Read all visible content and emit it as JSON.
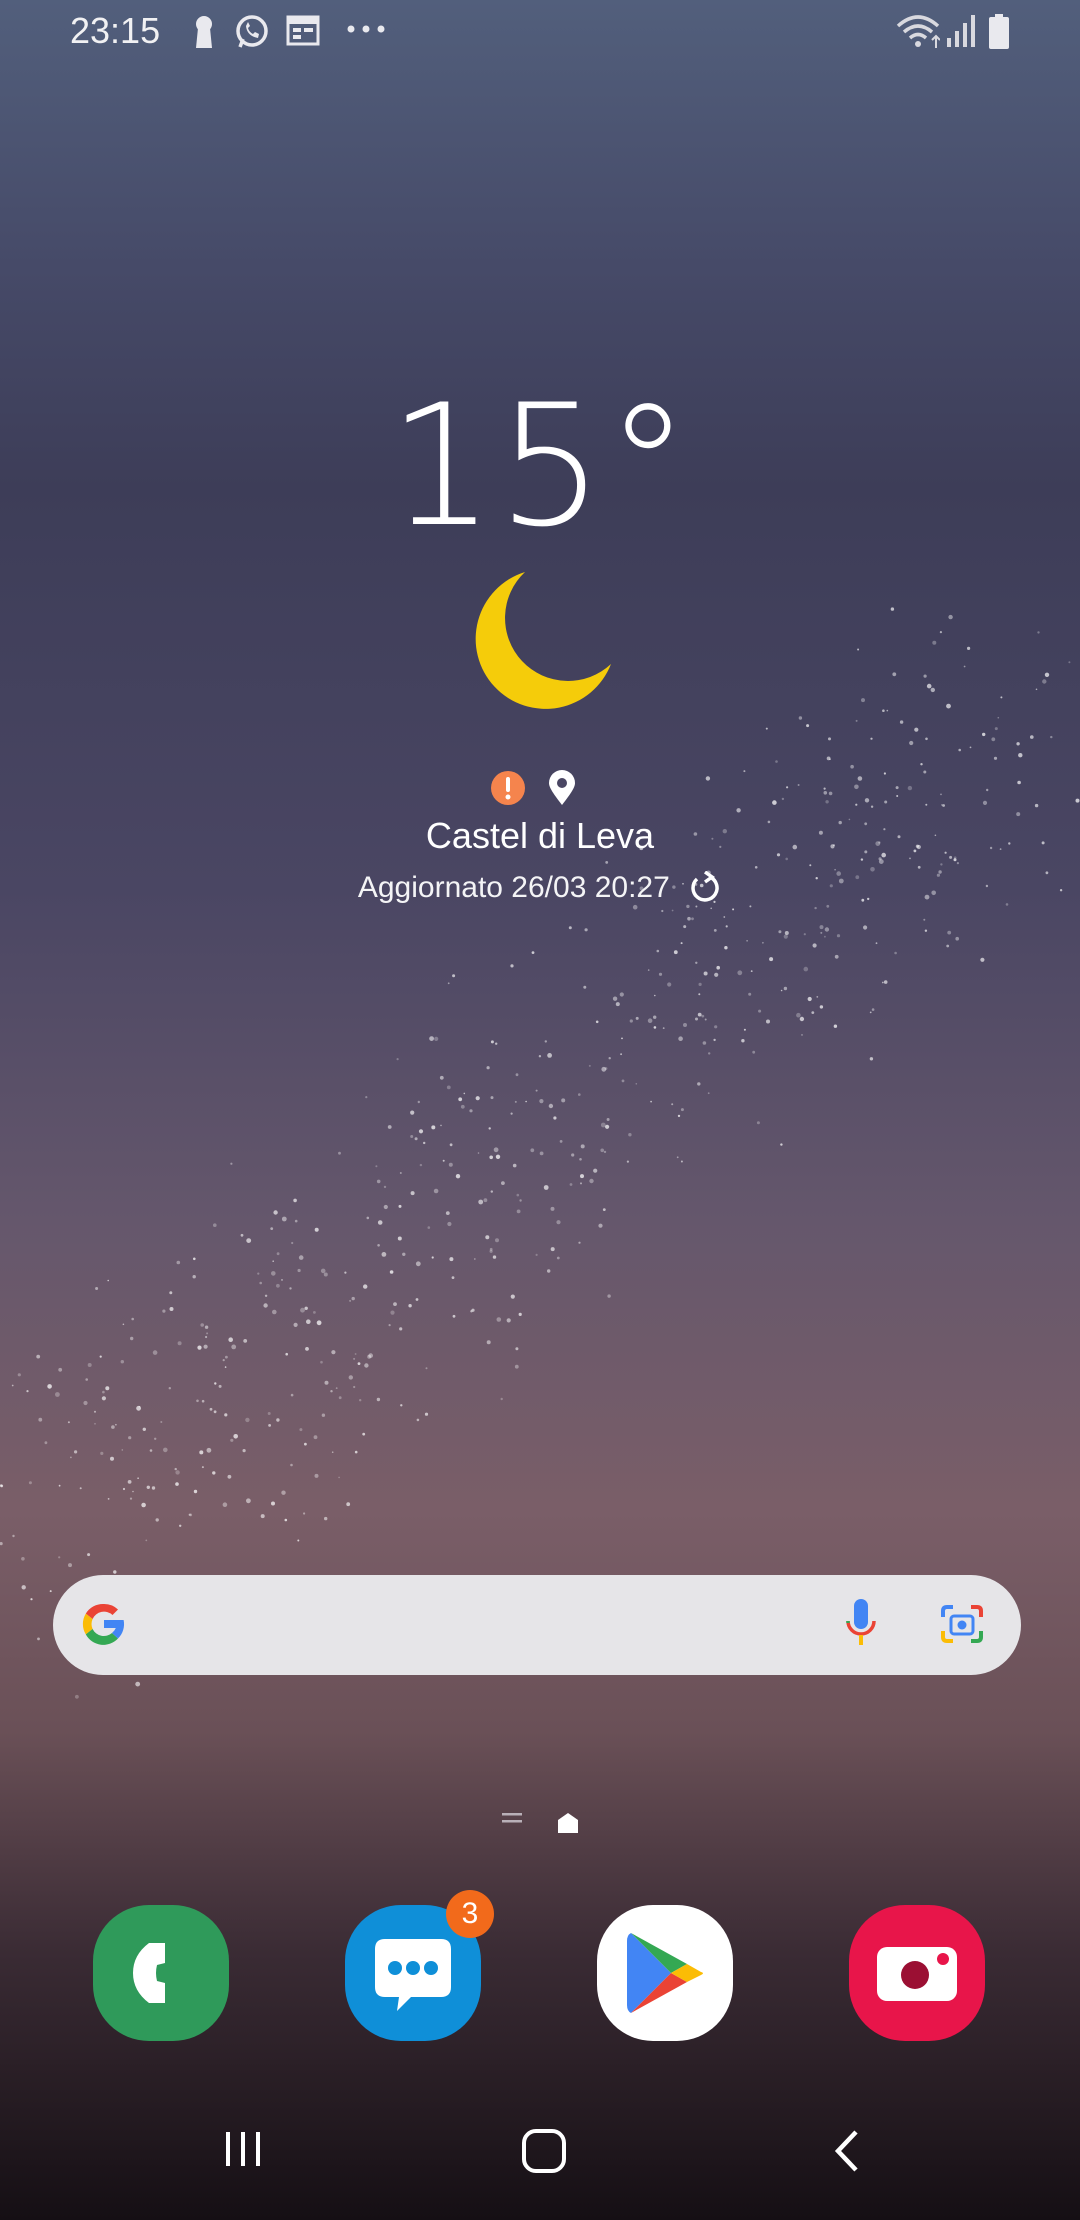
{
  "status_bar": {
    "time": "23:15",
    "left_icons": [
      "keyhole-icon",
      "whatsapp-icon",
      "calendar-icon",
      "more-dots-icon"
    ],
    "right_icons": [
      "wifi-icon",
      "signal-icon",
      "battery-icon"
    ]
  },
  "weather": {
    "temperature": "15°",
    "condition_icon": "moon-icon",
    "alert_icon": "alert-icon",
    "location_icon": "location-pin-icon",
    "city": "Castel di Leva",
    "updated": "Aggiornato 26/03 20:27"
  },
  "search": {
    "logo": "google-logo-icon",
    "mic_icon": "mic-icon",
    "lens_icon": "google-lens-icon"
  },
  "page_indicator": {
    "pages": [
      "list-page-icon",
      "home-page-icon"
    ],
    "active": "home-page-icon"
  },
  "dock": {
    "apps": [
      {
        "name": "phone",
        "icon": "phone-icon",
        "color": "#2f9a5a"
      },
      {
        "name": "messages",
        "icon": "messages-icon",
        "color": "#0f8fd8",
        "badge": "3"
      },
      {
        "name": "play-store",
        "icon": "play-store-icon",
        "color": "#ffffff"
      },
      {
        "name": "camera",
        "icon": "camera-icon",
        "color": "#e8154a"
      }
    ]
  },
  "nav_bar": {
    "buttons": [
      "recents-icon",
      "home-icon",
      "back-icon"
    ]
  }
}
